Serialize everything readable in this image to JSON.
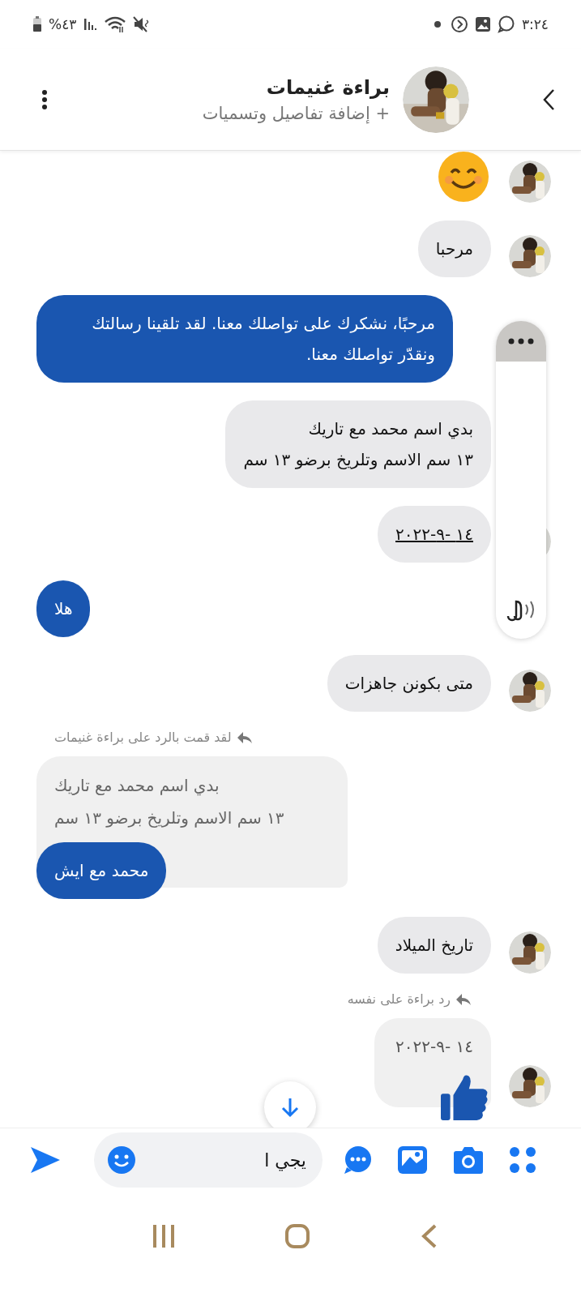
{
  "status_bar": {
    "time": "٣:٢٤",
    "battery": "%٤٣"
  },
  "header": {
    "name": "براءة غنيمات",
    "subtitle": "+ إضافة تفاصيل وتسميات"
  },
  "messages": [
    {
      "kind": "emoji",
      "avatar": true
    },
    {
      "kind": "incoming",
      "text": "مرحبا",
      "avatar": true
    },
    {
      "kind": "outgoing",
      "text": "مرحبًا، نشكرك على تواصلك معنا. لقد تلقينا رسالتك ونقدّر تواصلك معنا."
    },
    {
      "kind": "incoming",
      "lines": [
        "بدي اسم محمد مع تاريك",
        "١٣ سم الاسم وتلريخ برضو ١٣ سم"
      ],
      "avatar": false
    },
    {
      "kind": "incoming",
      "text": "١٤ -٩-٢٠٢٢",
      "underlined": true,
      "avatar": true
    },
    {
      "kind": "outgoing",
      "text": "هلا"
    },
    {
      "kind": "incoming",
      "text": "متى بكونن جاهزات",
      "avatar": true
    },
    {
      "kind": "reply_label_out",
      "text": "لقد قمت بالرد على براءة غنيمات"
    },
    {
      "kind": "quoted_reply",
      "quote": [
        "بدي اسم محمد مع تاريك",
        "١٣ سم الاسم وتلريخ برضو ١٣ سم"
      ],
      "text": "محمد مع ايش"
    },
    {
      "kind": "incoming",
      "text": "تاريخ الميلاد",
      "avatar": true
    },
    {
      "kind": "reply_label_in",
      "text": "رد براءة على نفسه"
    },
    {
      "kind": "incoming_quote",
      "text": "١٤ -٩-٢٠٢٢",
      "liked": true,
      "avatar": true
    }
  ],
  "composer": {
    "value": "يجي ا"
  }
}
